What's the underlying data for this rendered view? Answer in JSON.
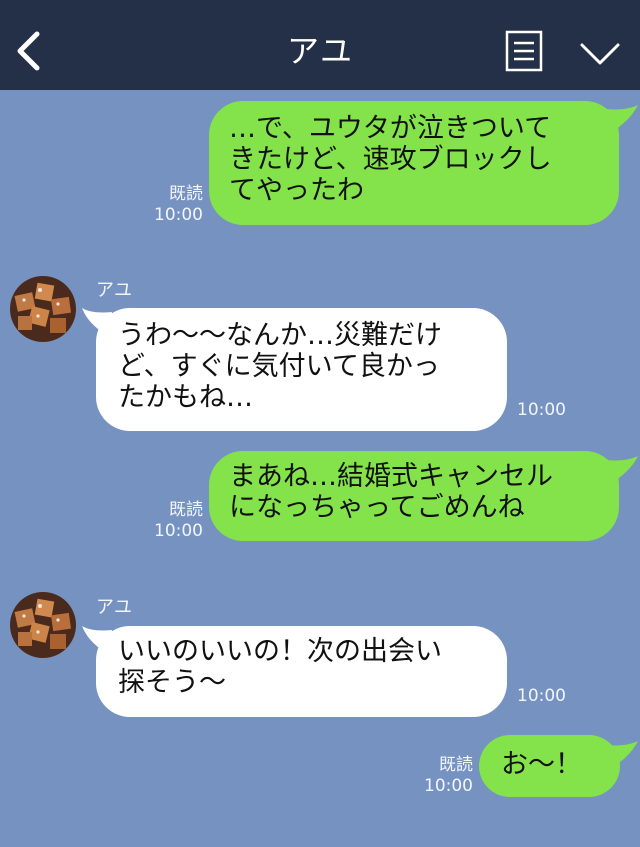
{
  "header": {
    "title": "アユ",
    "back_icon": "chevron-left-icon",
    "menu_icon": "menu-icon",
    "collapse_icon": "chevron-down-icon",
    "background": "#243047"
  },
  "chat": {
    "background": "#7592c1",
    "my_bubble_color": "#84e34a",
    "their_bubble_color": "#ffffff",
    "messages": [
      {
        "from": "me",
        "text": "…で、ユウタが泣きついて\nきたけど、速攻ブロックし\nてやったわ",
        "read": "既読",
        "time": "10:00"
      },
      {
        "from": "them",
        "sender": "アユ",
        "text": "うわ〜〜なんか…災難だけ\nど、すぐに気付いて良かっ\nたかもね…",
        "time": "10:00"
      },
      {
        "from": "me",
        "text": "まあね…結婚式キャンセル\nになっちゃってごめんね",
        "read": "既読",
        "time": "10:00"
      },
      {
        "from": "them",
        "sender": "アユ",
        "text": "いいのいいの！次の出会い\n探そう〜",
        "time": "10:00"
      },
      {
        "from": "me",
        "text": "お〜！",
        "read": "既読",
        "time": "10:00"
      }
    ]
  }
}
